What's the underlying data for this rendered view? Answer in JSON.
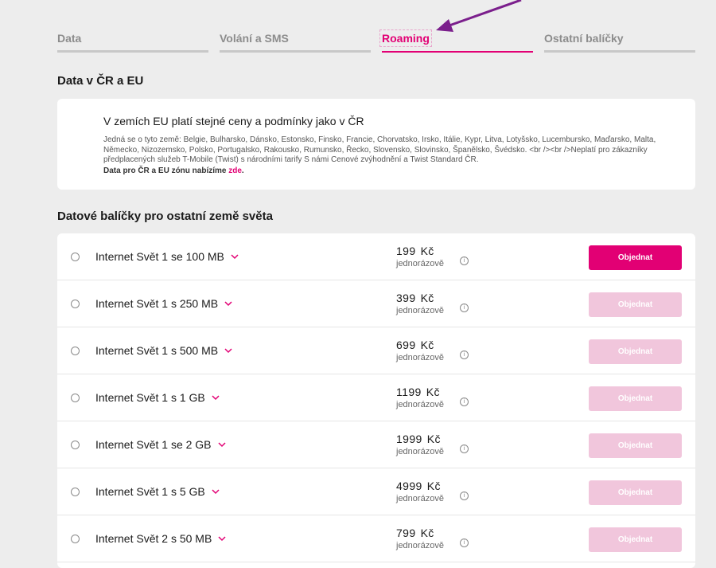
{
  "tabs": [
    {
      "label": "Data",
      "active": false
    },
    {
      "label": "Volání a SMS",
      "active": false
    },
    {
      "label": "Roaming",
      "active": true
    },
    {
      "label": "Ostatní balíčky",
      "active": false
    }
  ],
  "annotation": {
    "icon": "arrow-icon",
    "color": "#7b1f8c"
  },
  "eu_section": {
    "heading": "Data v ČR a EU",
    "card_title": "V zemích EU platí stejné ceny a podmínky jako v ČR",
    "description": "Jedná se o tyto země: Belgie, Bulharsko, Dánsko, Estonsko, Finsko, Francie, Chorvatsko, Irsko, Itálie, Kypr, Litva, Lotyšsko, Lucembursko, Maďarsko, Malta, Německo, Nizozemsko, Polsko, Portugalsko, Rakousko, Rumunsko, Řecko, Slovensko, Slovinsko, Španělsko, Švédsko. <br /><br />Neplatí pro zákazníky předplacených služeb T-Mobile (Twist) s národními tarify S námi Cenové zvýhodnění a Twist Standard ČR.",
    "link_prefix": "Data pro ČR a EU zónu nabízíme",
    "link_text": "zde",
    "link_suffix": "."
  },
  "packages_section": {
    "heading": "Datové balíčky pro ostatní země světa",
    "price_note": "jednorázově",
    "currency": "Kč",
    "order_label": "Objednat",
    "items": [
      {
        "name": "Internet Svět 1 se 100 MB",
        "price": "199",
        "primary": true
      },
      {
        "name": "Internet Svět 1 s 250 MB",
        "price": "399",
        "primary": false
      },
      {
        "name": "Internet Svět 1 s 500 MB",
        "price": "699",
        "primary": false
      },
      {
        "name": "Internet Svět 1 s 1 GB",
        "price": "1199",
        "primary": false
      },
      {
        "name": "Internet Svět 1 se 2 GB",
        "price": "1999",
        "primary": false
      },
      {
        "name": "Internet Svět 1 s 5 GB",
        "price": "4999",
        "primary": false
      },
      {
        "name": "Internet Svět 2 s 50 MB",
        "price": "799",
        "primary": false
      }
    ]
  },
  "colors": {
    "brand": "#e20074",
    "brand_disabled": "#f1c6dc",
    "background": "#ededed"
  }
}
